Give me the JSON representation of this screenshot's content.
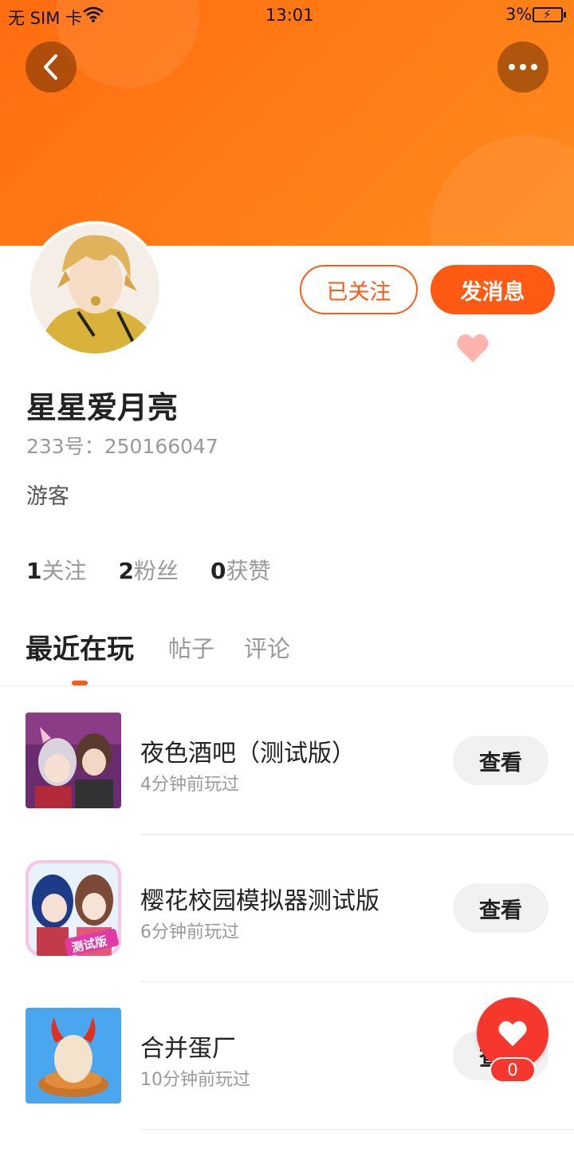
{
  "status_bar": {
    "carrier": "无 SIM 卡",
    "time": "13:01",
    "battery_percent": "3%"
  },
  "colors": {
    "accent": "#ff5a14",
    "header_gradient": [
      "#ff6d10",
      "#ff8a1c"
    ],
    "fab": "#f5372e"
  },
  "icons": {
    "back": "back-arrow-icon",
    "more": "more-dots-icon",
    "like": "heart-icon",
    "fab": "heart-icon"
  },
  "profile": {
    "name": "星星爱月亮",
    "id_label": "233号：250166047",
    "role": "游客",
    "follow_label": "已关注",
    "message_label": "发消息"
  },
  "stats": [
    {
      "count": "1",
      "label": "关注"
    },
    {
      "count": "2",
      "label": "粉丝"
    },
    {
      "count": "0",
      "label": "获赞"
    }
  ],
  "tabs": [
    "最近在玩",
    "帖子",
    "评论"
  ],
  "games": [
    {
      "name": "夜色酒吧（测试版）",
      "time": "4分钟前玩过",
      "button": "查看"
    },
    {
      "name": "樱花校园模拟器测试版",
      "time": "6分钟前玩过",
      "button": "查看",
      "badge": "测试版"
    },
    {
      "name": "合并蛋厂",
      "time": "10分钟前玩过",
      "button": "查看"
    }
  ],
  "fab": {
    "count": "0"
  }
}
